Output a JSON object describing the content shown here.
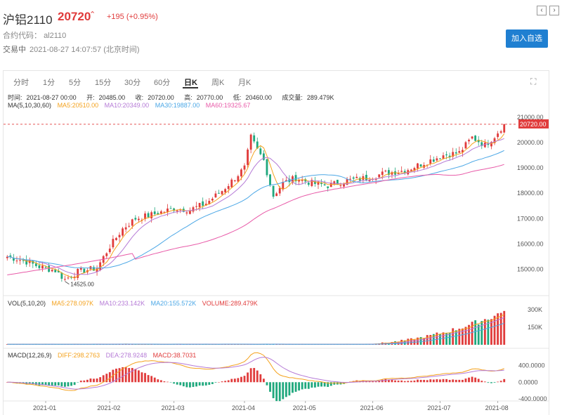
{
  "header": {
    "title": "沪铝2110",
    "price": "20720",
    "arrow": "⌃",
    "change": "+195 (+0.95%)",
    "code_label": "合约代码：",
    "code_value": "al2110",
    "status": "交易中",
    "time": "2021-08-27 14:07:57 (北京时间)",
    "add_fav": "加入自选",
    "prev_icon": "chevron-left-icon",
    "next_icon": "chevron-right-icon"
  },
  "tabs": [
    "分时",
    "1分",
    "5分",
    "15分",
    "30分",
    "60分",
    "日K",
    "周K",
    "月K"
  ],
  "active_tab": "日K",
  "bar_info": {
    "time_label": "时间:",
    "time": "2021-08-27 00:00",
    "open_label": "开:",
    "open": "20485.00",
    "close_label": "收:",
    "close": "20720.00",
    "high_label": "高:",
    "high": "20770.00",
    "low_label": "低:",
    "low": "20460.00",
    "vol_label": "成交量:",
    "vol": "289.479K"
  },
  "ma_legend": {
    "label": "MA(5,10,30,60)",
    "ma5": "MA5:20510.00",
    "ma10": "MA10:20349.00",
    "ma30": "MA30:19887.00",
    "ma60": "MA60:19325.67"
  },
  "vol_legend": {
    "label": "VOL(5,10,20)",
    "ma5": "MA5:278.097K",
    "ma10": "MA10:233.142K",
    "ma20": "MA20:155.572K",
    "volume": "VOLUME:289.479K"
  },
  "macd_legend": {
    "label": "MACD(12,26,9)",
    "diff": "DIFF:298.2763",
    "dea": "DEA:278.9248",
    "macd": "MACD:38.7031"
  },
  "colors": {
    "up": "#e03b3b",
    "down": "#1fa87d",
    "ma5": "#f4a21d",
    "ma10": "#b57ad6",
    "ma30": "#4ba7e6",
    "ma60": "#e85aa8",
    "accent": "#1f7fd1"
  },
  "chart_data": {
    "type": "candlestick",
    "price_ticks": [
      "21000.00",
      "20000.00",
      "19000.00",
      "18000.00",
      "17000.00",
      "16000.00",
      "15000.00"
    ],
    "price_ylim": [
      14100,
      21300
    ],
    "current_price": "20720.00",
    "low_marker": "14525.00",
    "vol_ticks": [
      "300K",
      "150K"
    ],
    "macd_ticks": [
      "400.0000",
      "0.0000",
      "-400.0000"
    ],
    "x_ticks": [
      "2021-01",
      "2021-02",
      "2021-03",
      "2021-04",
      "2021-05",
      "2021-06",
      "2021-07",
      "2021-08"
    ],
    "control_points": [
      [
        0,
        15500
      ],
      [
        5,
        15350
      ],
      [
        10,
        15100
      ],
      [
        15,
        14950
      ],
      [
        18,
        14600
      ],
      [
        22,
        14900
      ],
      [
        28,
        15050
      ],
      [
        32,
        15900
      ],
      [
        36,
        16600
      ],
      [
        40,
        17000
      ],
      [
        45,
        17150
      ],
      [
        52,
        17400
      ],
      [
        57,
        17350
      ],
      [
        62,
        17600
      ],
      [
        67,
        18100
      ],
      [
        71,
        18600
      ],
      [
        74,
        19000
      ],
      [
        76,
        20200
      ],
      [
        78,
        19700
      ],
      [
        80,
        19300
      ],
      [
        83,
        17900
      ],
      [
        86,
        18400
      ],
      [
        90,
        18600
      ],
      [
        95,
        18400
      ],
      [
        100,
        18300
      ],
      [
        106,
        18500
      ],
      [
        112,
        18600
      ],
      [
        118,
        18800
      ],
      [
        124,
        18900
      ],
      [
        130,
        19200
      ],
      [
        136,
        19500
      ],
      [
        141,
        19600
      ],
      [
        145,
        20200
      ],
      [
        149,
        19900
      ],
      [
        152,
        20250
      ],
      [
        155,
        20720
      ]
    ],
    "bar_count": 156
  }
}
